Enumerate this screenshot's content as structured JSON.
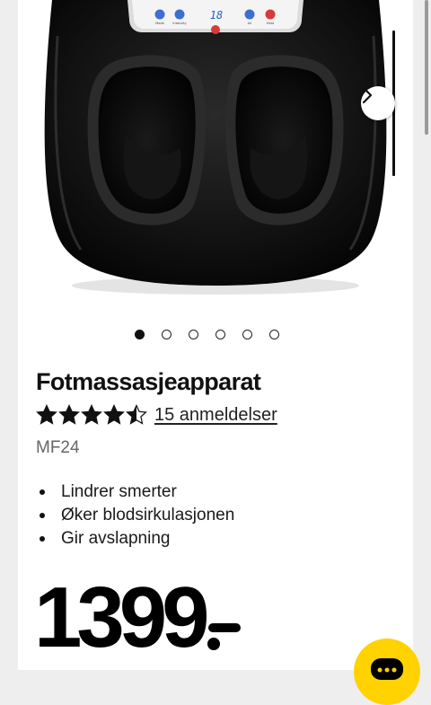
{
  "product": {
    "title": "Fotmassasjeapparat",
    "rating": {
      "value": 4.5,
      "max": 5,
      "reviews_label": "15 anmeldelser"
    },
    "model": "MF24",
    "features": [
      "Lindrer smerter",
      "Øker blodsirkulasjonen",
      "Gir avslapning"
    ],
    "price": "1399"
  },
  "gallery": {
    "image_count": 6,
    "active_index": 0,
    "device": {
      "display": "18",
      "button_labels": [
        "Mode",
        "Intensity",
        "Air",
        "Heat"
      ]
    }
  },
  "icons": {
    "next": "chevron-right-icon",
    "chat": "chat-icon",
    "star": "star-icon"
  },
  "colors": {
    "accent": "#ffd200",
    "text": "#111111",
    "muted": "#666666",
    "background": "#eeeeee"
  }
}
